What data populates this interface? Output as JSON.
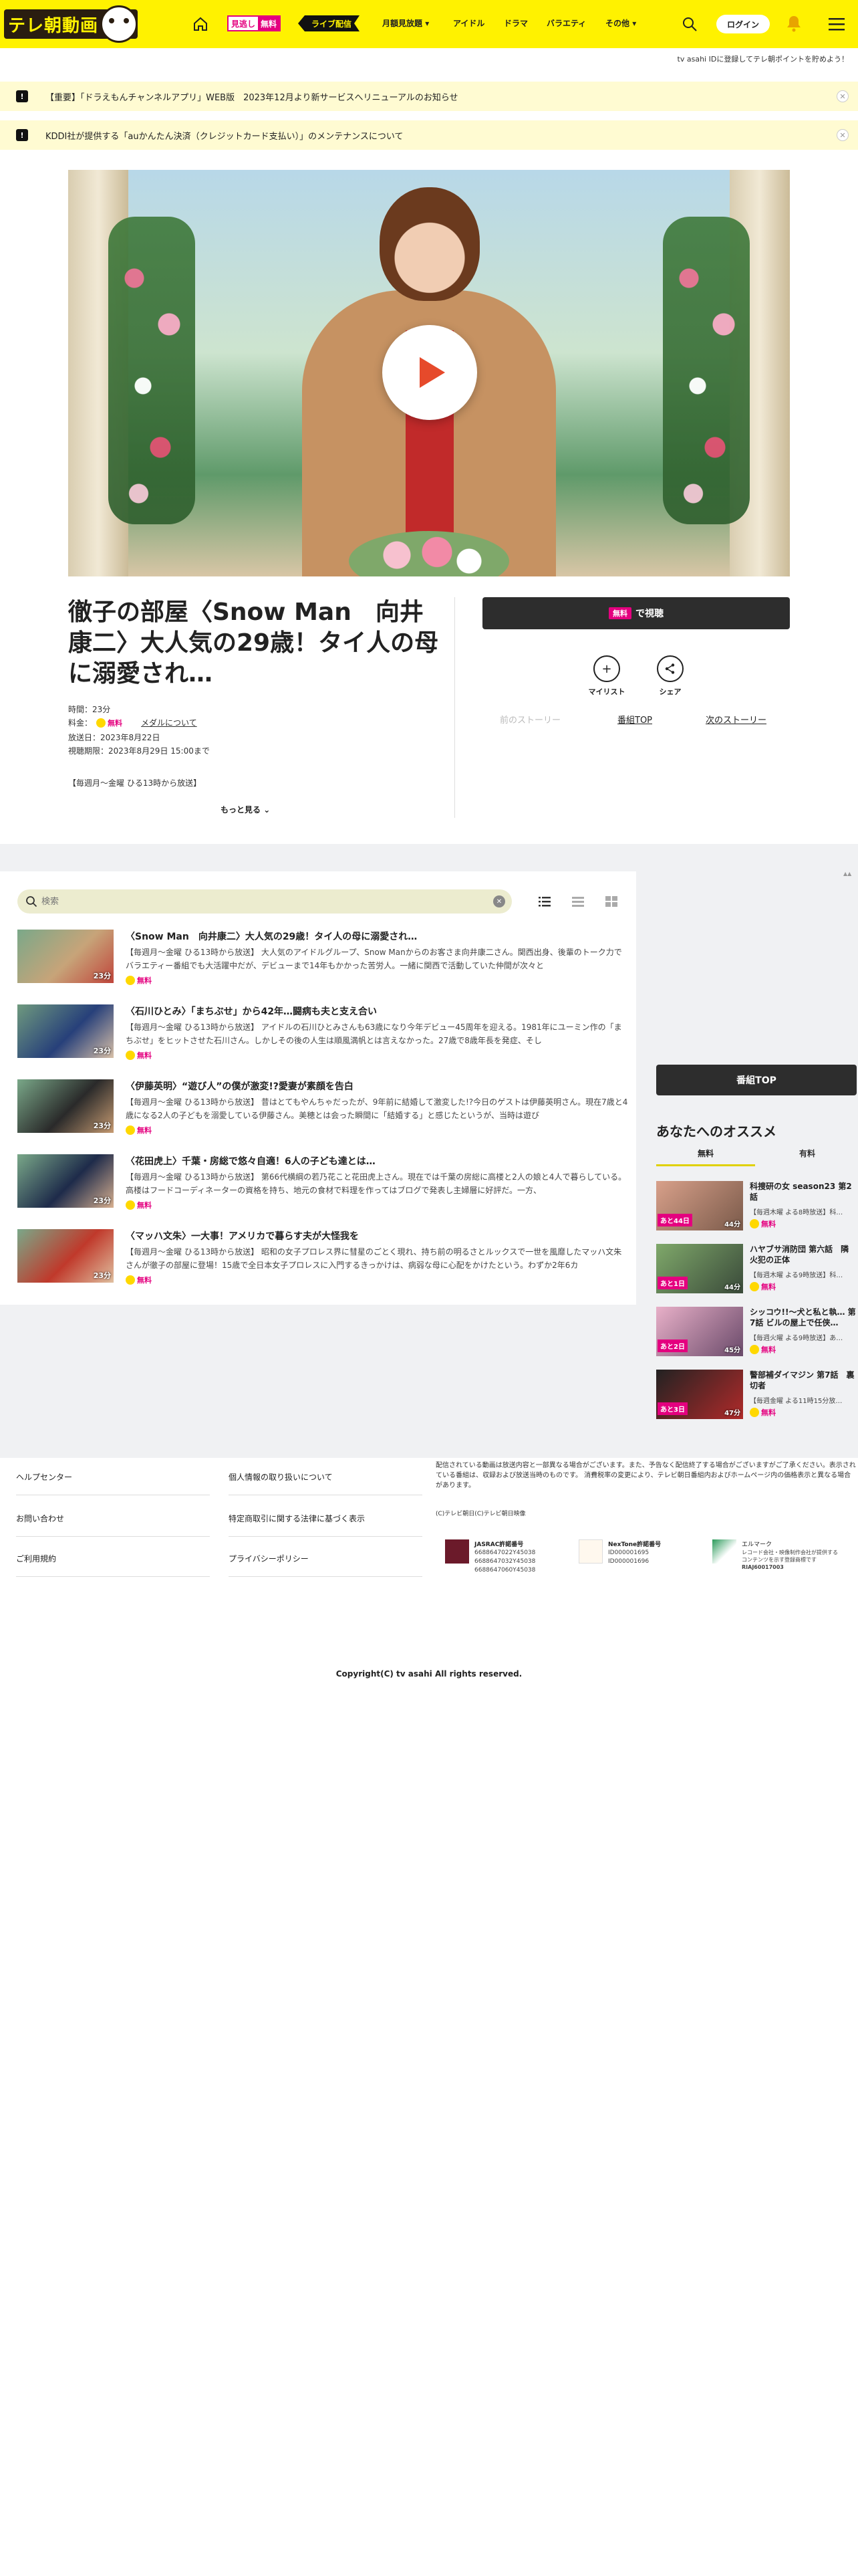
{
  "header": {
    "logo_text": "テレ朝動画",
    "free_pill": {
      "left": "見逃し",
      "right": "無料"
    },
    "live_label": "ライブ配信",
    "nav": [
      "月額見放題",
      "アイドル",
      "ドラマ",
      "バラエティ",
      "その他"
    ],
    "login_label": "ログイン"
  },
  "subbar_text": "tv asahi IDに登録してテレ朝ポイントを貯めよう！",
  "notices": [
    "【重要】「ドラえもんチャンネルアプリ」WEB版　2023年12月より新サービスへリニューアルのお知らせ",
    "KDDI社が提供する「auかんたん決済（クレジットカード支払い）」のメンテナンスについて"
  ],
  "episode": {
    "title": "徹子の部屋〈Snow Man　向井康二〉大人気の29歳！タイ人の母に溺愛され…",
    "duration": "時間：23分",
    "price_label": "料金：",
    "free": "無料",
    "medal_link": "メダルについて",
    "air_date": "放送日：2023年8月22日",
    "deadline": "視聴期限：2023年8月29日 15:00まで",
    "schedule": "【毎週月～金曜 ひる13時から放送】",
    "more": "もっと見る"
  },
  "actions": {
    "watch_free": "無料",
    "watch_label": "で視聴",
    "mylist": "マイリスト",
    "share": "シェア",
    "prev_story": "前のストーリー",
    "program_top": "番組TOP",
    "next_story": "次のストーリー"
  },
  "list": {
    "search_placeholder": "検索",
    "items": [
      {
        "title": "〈Snow Man　向井康二〉大人気の29歳！タイ人の母に溺愛され…",
        "desc": "【毎週月～金曜 ひる13時から放送】 大人気のアイドルグループ、Snow Manからのお客さま向井康二さん。関西出身、後輩のトーク力でバラエティー番組でも大活躍中だが、デビューまで14年もかかった苦労人。一緒に関西で活動していた仲間が次々と",
        "duration": "23分",
        "free": "無料"
      },
      {
        "title": "〈石川ひとみ〉「まちぶせ」から42年…闘病も夫と支え合い",
        "desc": "【毎週月～金曜 ひる13時から放送】 アイドルの石川ひとみさんも63歳になり今年デビュー45周年を迎える。1981年にユーミン作の「まちぶせ」をヒットさせた石川さん。しかしその後の人生は順風満帆とは言えなかった。27歳で8歳年長を発症、そし",
        "duration": "23分",
        "free": "無料"
      },
      {
        "title": "〈伊藤英明〉“遊び人”の僕が激変!?愛妻が素顔を告白",
        "desc": "【毎週月～金曜 ひる13時から放送】 昔はとてもやんちゃだったが、9年前に結婚して激変した!?今日のゲストは伊藤英明さん。現在7歳と4歳になる2人の子どもを溺愛している伊藤さん。美穂とは会った瞬間に「結婚する」と感じたというが、当時は遊び",
        "duration": "23分",
        "free": "無料"
      },
      {
        "title": "〈花田虎上〉千葉・房総で悠々自適！6人の子ども達とは…",
        "desc": "【毎週月～金曜 ひる13時から放送】 第66代横綱の若乃花こと花田虎上さん。現在では千葉の房総に高楼と2人の娘と4人で暮らしている。高楼はフードコーディネーターの資格を持ち、地元の食材で料理を作ってはブログで発表し主婦層に好評だ。一方、",
        "duration": "23分",
        "free": "無料"
      },
      {
        "title": "〈マッハ文朱〉一大事！アメリカで暮らす夫が大怪我を",
        "desc": "【毎週月～金曜 ひる13時から放送】 昭和の女子プロレス界に彗星のごとく現れ、持ち前の明るさとルックスで一世を風靡したマッハ文朱さんが徹子の部屋に登場！15歳で全日本女子プロレスに入門するきっかけは、病弱な母に心配をかけたという。わずか2年6カ",
        "duration": "23分",
        "free": "無料"
      }
    ]
  },
  "sidebar": {
    "program_top": "番組TOP",
    "heading": "あなたへのオススメ",
    "tabs": [
      "無料",
      "有料"
    ],
    "recs": [
      {
        "title": "科捜研の女 season23 第2話",
        "desc": "【毎週木曜 よる8時放送】科…",
        "remain": "あと44日",
        "duration": "44分",
        "free": "無料"
      },
      {
        "title": "ハヤブサ消防団 第六話　隣火犯の正体",
        "desc": "【毎週木曜 よる9時放送】科…",
        "remain": "あと1日",
        "duration": "44分",
        "free": "無料"
      },
      {
        "title": "シッコウ!!～犬と私と執… 第7話 ビルの屋上で任侠…",
        "desc": "【毎週火曜 よる9時放送】あ…",
        "remain": "あと2日",
        "duration": "45分",
        "free": "無料"
      },
      {
        "title": "警部補ダイマジン 第7話　裏切者",
        "desc": "【毎週金曜 よる11時15分放…",
        "remain": "あと3日",
        "duration": "47分",
        "free": "無料"
      }
    ]
  },
  "footer": {
    "col1": [
      "ヘルプセンター",
      "お問い合わせ",
      "ご利用規約"
    ],
    "col2": [
      "個人情報の取り扱いについて",
      "特定商取引に関する法律に基づく表示",
      "プライバシーポリシー"
    ],
    "disclaimer": "配信されている動画は放送内容と一部異なる場合がございます。また、予告なく配信終了する場合がございますがご了承ください。表示されている番組は、収録および放送当時のものです。 消費税率の変更により、テレビ朝日番組内およびホームページ内の価格表示と異なる場合があります。",
    "credit": "(C)テレビ朝日(C)テレビ朝日映像",
    "licenses": [
      {
        "title": "JASRAC許諾番号",
        "nums": [
          "6688647022Y45038",
          "6688647032Y45038",
          "6688647060Y45038"
        ]
      },
      {
        "title": "NexTone許諾番号",
        "nums": [
          "ID000001695",
          "ID000001696"
        ]
      },
      {
        "title": "エルマーク",
        "nums": [
          "レコード会社・映像制作会社が提供するコンテンツを示す登録商標です",
          "RIAJ60017003"
        ]
      }
    ],
    "copyright": "Copyright(C) tv asahi All rights reserved."
  },
  "colors": {
    "header_yellow": "#fff200",
    "accent_pink": "#e4007f",
    "dark_button": "#2d2d2d",
    "notice_bg": "#fffbd2"
  }
}
